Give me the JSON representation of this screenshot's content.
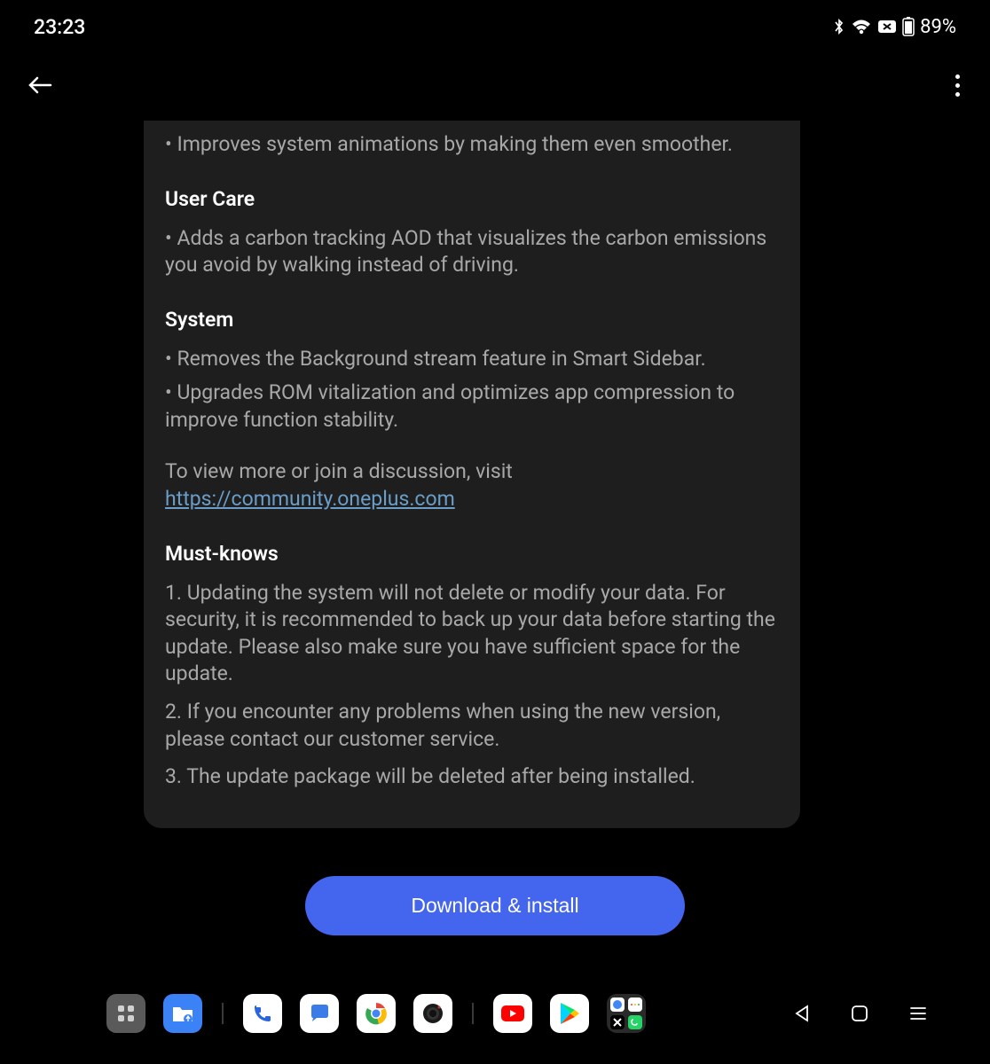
{
  "status_bar": {
    "time": "23:23",
    "battery_percent": "89%"
  },
  "content": {
    "animations_bullet": "• Improves system animations by making them even smoother.",
    "user_care": {
      "title": "User Care",
      "bullet1": "• Adds a carbon tracking AOD that visualizes the carbon emissions you avoid by walking instead of driving."
    },
    "system": {
      "title": "System",
      "bullet1": "• Removes the Background stream feature in Smart Sidebar.",
      "bullet2": "• Upgrades ROM vitalization and optimizes app compression to improve function stability."
    },
    "discussion_prefix": "To view more or join a discussion, visit",
    "discussion_link": "https://community.oneplus.com",
    "must_knows": {
      "title": "Must-knows",
      "item1": "1. Updating the system will not delete or modify your data. For security, it is recommended to back up your data before starting the update. Please also make sure you have sufficient space for the update.",
      "item2": "2. If you encounter any problems when using the new version, please contact our customer service.",
      "item3": "3. The update package will be deleted after being installed."
    }
  },
  "download_button": "Download & install"
}
